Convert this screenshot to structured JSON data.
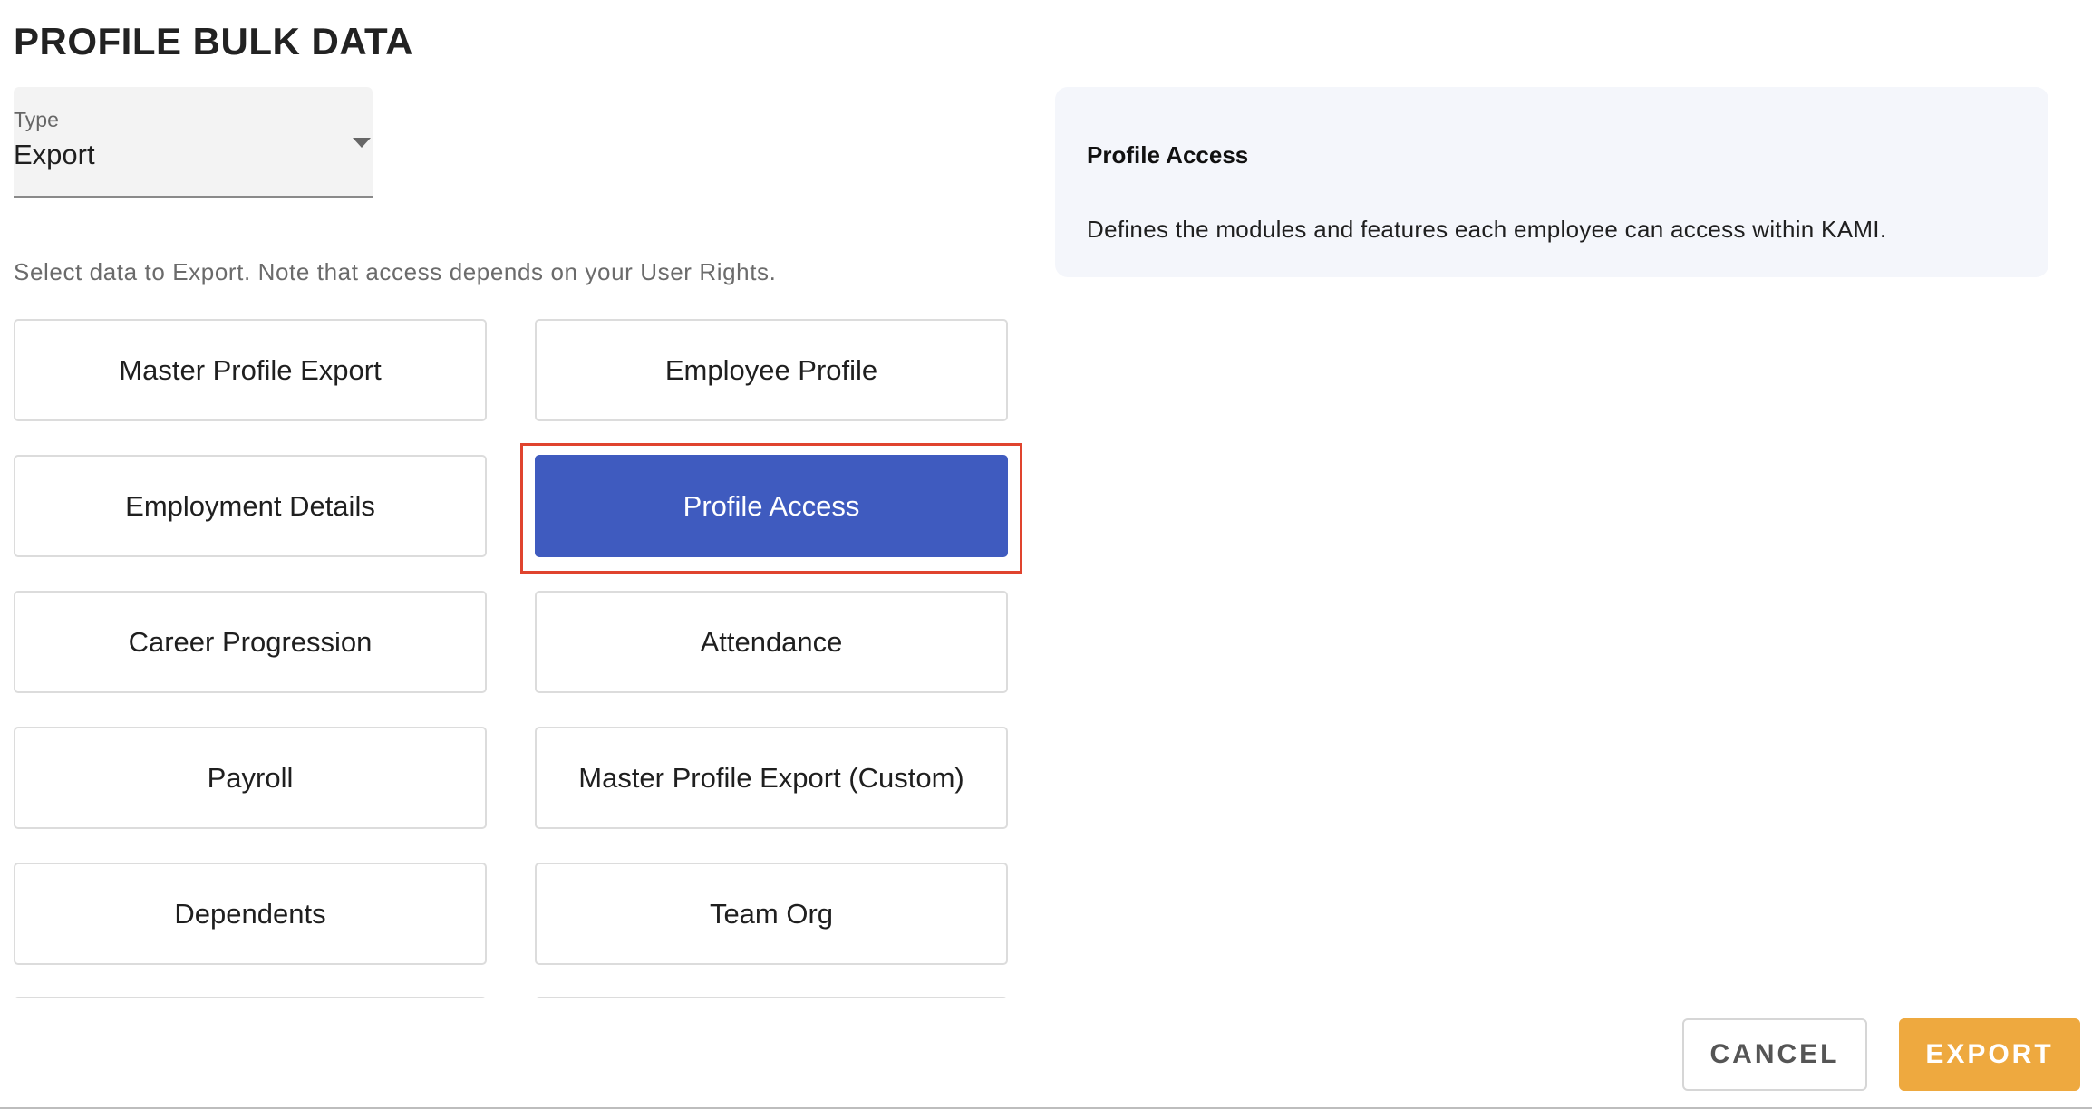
{
  "page": {
    "title": "PROFILE BULK DATA"
  },
  "type_select": {
    "label": "Type",
    "value": "Export"
  },
  "helper_text": "Select data to Export. Note that access depends on your User Rights.",
  "options": [
    {
      "label": "Master Profile Export",
      "selected": false
    },
    {
      "label": "Employee Profile",
      "selected": false
    },
    {
      "label": "Employment Details",
      "selected": false
    },
    {
      "label": "Profile Access",
      "selected": true
    },
    {
      "label": "Career Progression",
      "selected": false
    },
    {
      "label": "Attendance",
      "selected": false
    },
    {
      "label": "Payroll",
      "selected": false
    },
    {
      "label": "Master Profile Export (Custom)",
      "selected": false
    },
    {
      "label": "Dependents",
      "selected": false
    },
    {
      "label": "Team Org",
      "selected": false
    }
  ],
  "info_panel": {
    "title": "Profile Access",
    "description": "Defines the modules and features each employee can access within KAMI."
  },
  "footer": {
    "cancel_label": "CANCEL",
    "export_label": "EXPORT"
  },
  "colors": {
    "selected": "#3f5bbf",
    "export_button": "#eea93f",
    "highlight": "#e0442e",
    "info_panel_bg": "#f4f6fb"
  }
}
